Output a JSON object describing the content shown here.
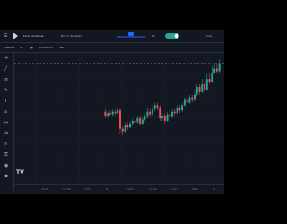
{
  "topbar": {
    "title": "Forex at Ginsie",
    "mode_label": "Not in Ukhaban",
    "right_label": "Clos"
  },
  "toolbar": {
    "symbol": "EURUSD",
    "interval": "1h",
    "indicators_label": "Indicators",
    "extra_label": "Tab"
  },
  "timeaxis": {
    "ticks": [
      "",
      "16:0",
      "12:00",
      "2:00",
      "8",
      "18:0",
      "17:00",
      "1:00",
      "06:0",
      "0"
    ]
  },
  "chart_data": {
    "type": "candlestick",
    "candles": [
      [
        0.55,
        0.52,
        0.57,
        0.5
      ],
      [
        0.52,
        0.54,
        0.55,
        0.5
      ],
      [
        0.54,
        0.53,
        0.56,
        0.52
      ],
      [
        0.53,
        0.55,
        0.57,
        0.51
      ],
      [
        0.55,
        0.54,
        0.57,
        0.52
      ],
      [
        0.54,
        0.56,
        0.58,
        0.53
      ],
      [
        0.56,
        0.42,
        0.58,
        0.38
      ],
      [
        0.42,
        0.4,
        0.44,
        0.37
      ],
      [
        0.4,
        0.45,
        0.47,
        0.39
      ],
      [
        0.45,
        0.43,
        0.47,
        0.41
      ],
      [
        0.43,
        0.46,
        0.48,
        0.42
      ],
      [
        0.46,
        0.48,
        0.5,
        0.44
      ],
      [
        0.48,
        0.47,
        0.5,
        0.45
      ],
      [
        0.47,
        0.5,
        0.52,
        0.46
      ],
      [
        0.5,
        0.46,
        0.52,
        0.44
      ],
      [
        0.46,
        0.49,
        0.51,
        0.45
      ],
      [
        0.49,
        0.51,
        0.53,
        0.48
      ],
      [
        0.51,
        0.55,
        0.58,
        0.5
      ],
      [
        0.55,
        0.53,
        0.57,
        0.51
      ],
      [
        0.53,
        0.57,
        0.6,
        0.52
      ],
      [
        0.57,
        0.6,
        0.62,
        0.55
      ],
      [
        0.6,
        0.58,
        0.62,
        0.56
      ],
      [
        0.58,
        0.5,
        0.6,
        0.48
      ],
      [
        0.5,
        0.52,
        0.54,
        0.48
      ],
      [
        0.52,
        0.48,
        0.54,
        0.46
      ],
      [
        0.48,
        0.53,
        0.55,
        0.47
      ],
      [
        0.53,
        0.51,
        0.55,
        0.49
      ],
      [
        0.51,
        0.55,
        0.57,
        0.5
      ],
      [
        0.55,
        0.54,
        0.57,
        0.52
      ],
      [
        0.54,
        0.58,
        0.6,
        0.53
      ],
      [
        0.58,
        0.56,
        0.6,
        0.54
      ],
      [
        0.56,
        0.6,
        0.62,
        0.55
      ],
      [
        0.6,
        0.64,
        0.66,
        0.59
      ],
      [
        0.64,
        0.62,
        0.66,
        0.6
      ],
      [
        0.62,
        0.66,
        0.68,
        0.61
      ],
      [
        0.66,
        0.64,
        0.68,
        0.62
      ],
      [
        0.64,
        0.68,
        0.72,
        0.63
      ],
      [
        0.68,
        0.74,
        0.76,
        0.67
      ],
      [
        0.74,
        0.7,
        0.76,
        0.68
      ],
      [
        0.7,
        0.76,
        0.8,
        0.69
      ],
      [
        0.76,
        0.72,
        0.78,
        0.7
      ],
      [
        0.72,
        0.8,
        0.84,
        0.71
      ],
      [
        0.8,
        0.78,
        0.84,
        0.76
      ],
      [
        0.78,
        0.85,
        0.9,
        0.77
      ],
      [
        0.85,
        0.88,
        0.92,
        0.84
      ],
      [
        0.88,
        0.86,
        0.92,
        0.84
      ],
      [
        0.86,
        0.92,
        0.95,
        0.85
      ]
    ],
    "price_line": 0.92,
    "colors": {
      "up": "#26a69a",
      "down": "#ef5350"
    }
  }
}
